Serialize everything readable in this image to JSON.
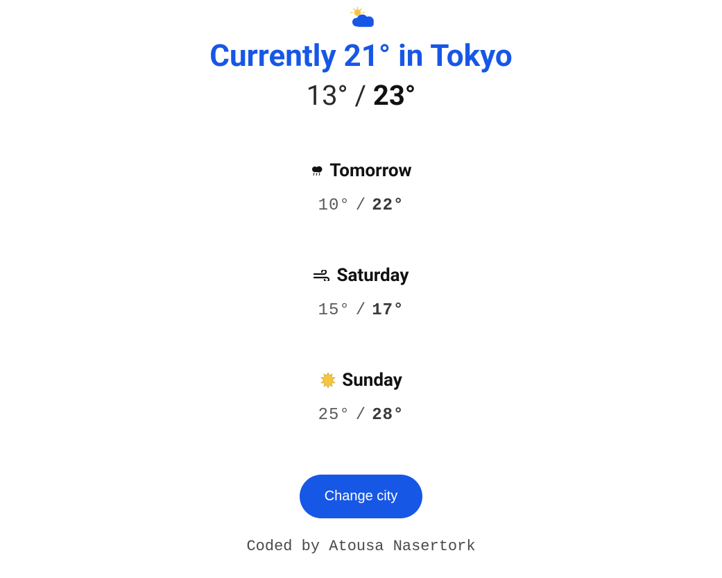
{
  "current": {
    "title": "Currently 21° in Tokyo",
    "low": "13°",
    "sep": " / ",
    "high": "23°"
  },
  "forecast": [
    {
      "label": "Tomorrow",
      "low": "10°",
      "high": "22°",
      "icon": "rain-cloud-icon"
    },
    {
      "label": "Saturday",
      "low": "15°",
      "high": "17°",
      "icon": "wind-icon"
    },
    {
      "label": "Sunday",
      "low": "25°",
      "high": "28°",
      "icon": "sun-icon"
    }
  ],
  "button": {
    "change_city": "Change city"
  },
  "footer": {
    "credit": "Coded by Atousa Nasertork"
  },
  "colors": {
    "primary": "#1757e6"
  }
}
